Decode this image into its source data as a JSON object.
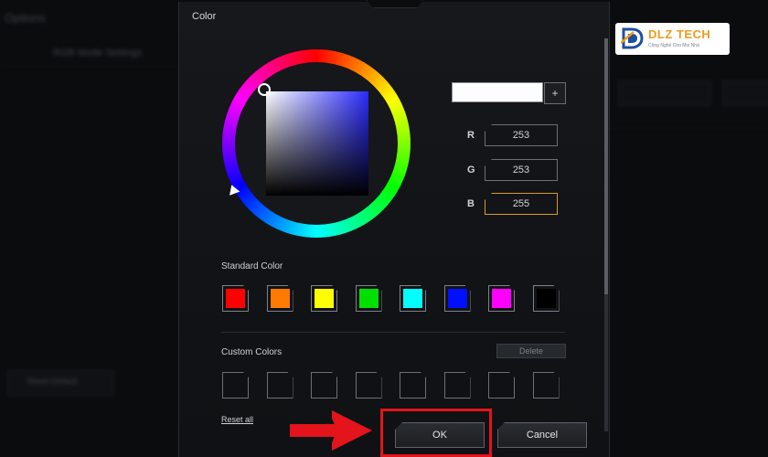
{
  "background": {
    "app_title": "Options",
    "tab_label": "RGB Mode Settings",
    "btn_label": "Reset Default"
  },
  "dialog": {
    "title": "Color",
    "preview_color": "#FDFDFF",
    "add_label": "+",
    "rgb": {
      "r_label": "R",
      "r_value": "253",
      "g_label": "G",
      "g_value": "253",
      "b_label": "B",
      "b_value": "255"
    },
    "standard_label": "Standard Color",
    "standard_colors": [
      "#FF0000",
      "#FF7A00",
      "#FFFF00",
      "#00E000",
      "#00FFFF",
      "#0010FF",
      "#FF00FF",
      "#000000"
    ],
    "custom_label": "Custom Colors",
    "delete_label": "Delete",
    "reset_label": "Reset all",
    "ok_label": "OK",
    "cancel_label": "Cancel"
  },
  "logo": {
    "text": "DLZ TECH",
    "sub": "Công Nghệ Cho Mọi Nhà"
  },
  "colors": {
    "highlight": "#E3141B",
    "active_field": "#D89B20",
    "logo_accent": "#F29A1E",
    "logo_blue": "#1E4F9C"
  }
}
